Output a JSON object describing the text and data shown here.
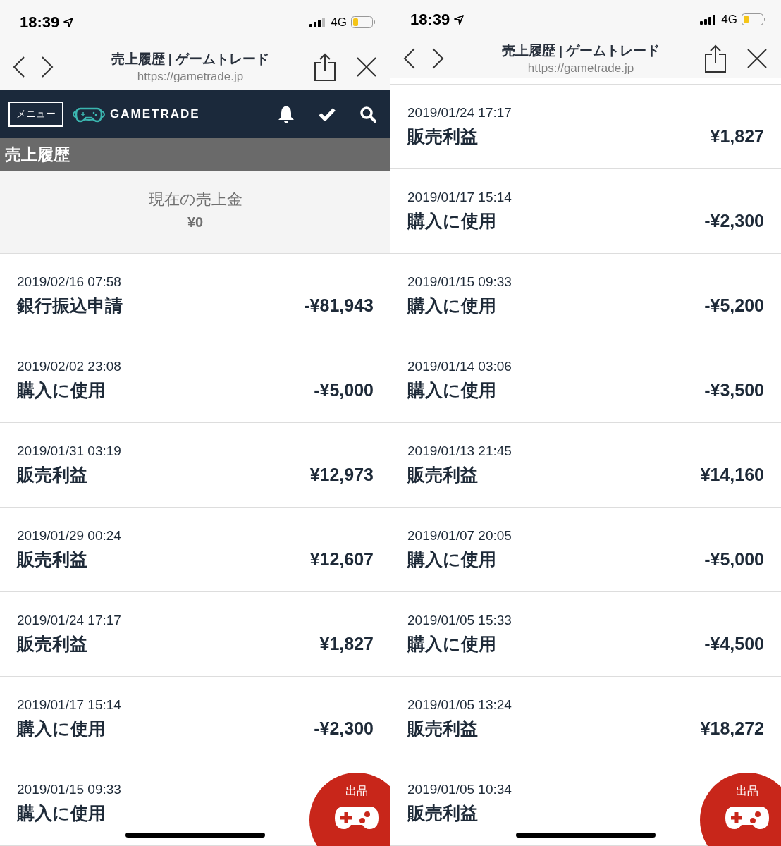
{
  "screens": [
    {
      "status_bar": {
        "time": "18:39",
        "network": "4G"
      },
      "browser": {
        "title": "売上履歴 | ゲームトレード",
        "url": "https://gametrade.jp"
      },
      "nav": {
        "menu_label": "メニュー",
        "logo_text": "GAMETRADE"
      },
      "page_title": "売上履歴",
      "balance": {
        "label": "現在の売上金",
        "amount": "¥0"
      },
      "transactions": [
        {
          "date": "2019/02/16 07:58",
          "type": "銀行振込申請",
          "amount": "-¥81,943"
        },
        {
          "date": "2019/02/02 23:08",
          "type": "購入に使用",
          "amount": "-¥5,000"
        },
        {
          "date": "2019/01/31 03:19",
          "type": "販売利益",
          "amount": "¥12,973"
        },
        {
          "date": "2019/01/29 00:24",
          "type": "販売利益",
          "amount": "¥12,607"
        },
        {
          "date": "2019/01/24 17:17",
          "type": "販売利益",
          "amount": "¥1,827"
        },
        {
          "date": "2019/01/17 15:14",
          "type": "購入に使用",
          "amount": "-¥2,300"
        },
        {
          "date": "2019/01/15 09:33",
          "type": "購入に使用"
        }
      ],
      "fab": {
        "label": "出品"
      }
    },
    {
      "status_bar": {
        "time": "18:39",
        "network": "4G"
      },
      "browser": {
        "title": "売上履歴 | ゲームトレード",
        "url": "https://gametrade.jp"
      },
      "transactions": [
        {
          "date": "2019/01/24 17:17",
          "type": "販売利益",
          "amount": "¥1,827"
        },
        {
          "date": "2019/01/17 15:14",
          "type": "購入に使用",
          "amount": "-¥2,300"
        },
        {
          "date": "2019/01/15 09:33",
          "type": "購入に使用",
          "amount": "-¥5,200"
        },
        {
          "date": "2019/01/14 03:06",
          "type": "購入に使用",
          "amount": "-¥3,500"
        },
        {
          "date": "2019/01/13 21:45",
          "type": "販売利益",
          "amount": "¥14,160"
        },
        {
          "date": "2019/01/07 20:05",
          "type": "購入に使用",
          "amount": "-¥5,000"
        },
        {
          "date": "2019/01/05 15:33",
          "type": "購入に使用",
          "amount": "-¥4,500"
        },
        {
          "date": "2019/01/05 13:24",
          "type": "販売利益",
          "amount": "¥18,272"
        },
        {
          "date": "2019/01/05 10:34",
          "type": "販売利益"
        }
      ],
      "fab": {
        "label": "出品"
      }
    }
  ]
}
